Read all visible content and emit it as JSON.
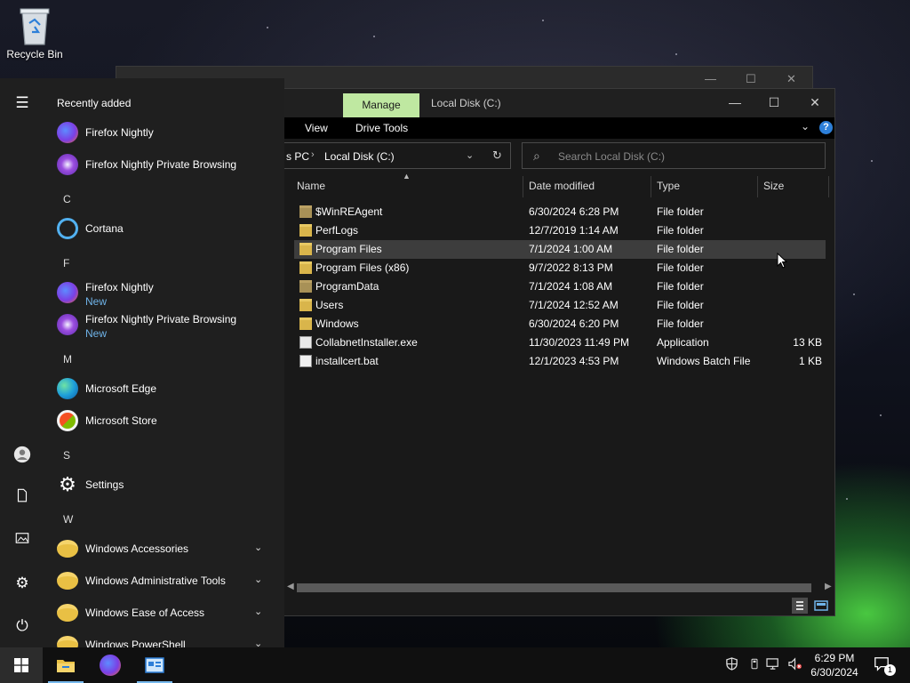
{
  "desktop": {
    "recycle_bin_label": "Recycle Bin"
  },
  "explorer": {
    "ribbon_context_tab": "Manage",
    "title": "Local Disk (C:)",
    "ribbon_tabs": {
      "view": "View",
      "drive_tools": "Drive Tools"
    },
    "help_glyph": "?",
    "address": {
      "parent": "s PC",
      "current": "Local Disk (C:)"
    },
    "search": {
      "placeholder": "Search Local Disk (C:)"
    },
    "columns": {
      "name": "Name",
      "date": "Date modified",
      "type": "Type",
      "size": "Size"
    },
    "rows": [
      {
        "name": "$WinREAgent",
        "date": "6/30/2024 6:28 PM",
        "type": "File folder",
        "size": "",
        "icon": "system-folder-icon"
      },
      {
        "name": "PerfLogs",
        "date": "12/7/2019 1:14 AM",
        "type": "File folder",
        "size": "",
        "icon": "folder-icon"
      },
      {
        "name": "Program Files",
        "date": "7/1/2024 1:00 AM",
        "type": "File folder",
        "size": "",
        "icon": "folder-icon",
        "selected": true
      },
      {
        "name": "Program Files (x86)",
        "date": "9/7/2022 8:13 PM",
        "type": "File folder",
        "size": "",
        "icon": "folder-icon"
      },
      {
        "name": "ProgramData",
        "date": "7/1/2024 1:08 AM",
        "type": "File folder",
        "size": "",
        "icon": "system-folder-icon"
      },
      {
        "name": "Users",
        "date": "7/1/2024 12:52 AM",
        "type": "File folder",
        "size": "",
        "icon": "folder-icon"
      },
      {
        "name": "Windows",
        "date": "6/30/2024 6:20 PM",
        "type": "File folder",
        "size": "",
        "icon": "folder-icon"
      },
      {
        "name": "CollabnetInstaller.exe",
        "date": "11/30/2023 11:49 PM",
        "type": "Application",
        "size": "13 KB",
        "icon": "exe-file-icon"
      },
      {
        "name": "installcert.bat",
        "date": "12/1/2023 4:53 PM",
        "type": "Windows Batch File",
        "size": "1 KB",
        "icon": "bat-file-icon"
      }
    ]
  },
  "start_menu": {
    "recently_added_title": "Recently added",
    "letters": {
      "c": "C",
      "f": "F",
      "m": "M",
      "s": "S",
      "w": "W"
    },
    "apps": {
      "firefox_nightly_recent": "Firefox Nightly",
      "firefox_private_recent": "Firefox Nightly Private Browsing",
      "cortana": "Cortana",
      "firefox_nightly": "Firefox Nightly",
      "firefox_nightly_new": "New",
      "firefox_private": "Firefox Nightly Private Browsing",
      "firefox_private_new": "New",
      "edge": "Microsoft Edge",
      "store": "Microsoft Store",
      "settings": "Settings",
      "win_accessories": "Windows Accessories",
      "win_admin_tools": "Windows Administrative Tools",
      "win_ease": "Windows Ease of Access",
      "win_powershell": "Windows PowerShell"
    }
  },
  "taskbar": {
    "time": "6:29 PM",
    "date": "6/30/2024",
    "notification_count": "1"
  },
  "colors": {
    "accent": "#76b9ed",
    "manage_tab": "#bfe8a1",
    "selection": "#3d3d3d",
    "new_badge": "#6fb3e8"
  }
}
